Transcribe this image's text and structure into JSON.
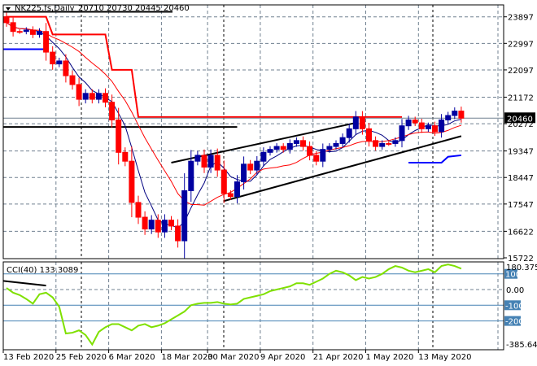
{
  "header": {
    "symbol_label": "NK225.fs,Daily",
    "ohlc_label": "20710 20730 20445 20460"
  },
  "indicator": {
    "label": "CCI(40) 133.3089"
  },
  "colors": {
    "bull": "#0000a0",
    "bear": "#ff0000",
    "ma_fast": "#000080",
    "ma_slow": "#ff0000",
    "step_line": "#ff0000",
    "cci": "#7fe000",
    "level": "#4682b4",
    "grid": "#708090"
  },
  "chart_data": [
    {
      "type": "candlestick",
      "title": "NK225.fs,Daily",
      "ylim": [
        15722,
        24400
      ],
      "y_ticks": [
        "23897",
        "22997",
        "22097",
        "21172",
        "20272",
        "19347",
        "18447",
        "17547",
        "16622",
        "15722"
      ],
      "y_tick_values": [
        23897,
        22997,
        22097,
        21172,
        20272,
        19347,
        18447,
        17547,
        16622,
        15722
      ],
      "current_price_label": "20460",
      "current_price": 20460,
      "x_tick_labels": [
        "13 Feb 2020",
        "25 Feb 2020",
        "6 Mar 2020",
        "18 Mar 2020",
        "30 Mar 2020",
        "9 Apr 2020",
        "21 Apr 2020",
        "1 May 2020",
        "13 May 2020"
      ],
      "x_tick_bars": [
        0,
        8,
        16,
        24,
        31,
        39,
        47,
        55,
        63
      ],
      "closes": [
        23700,
        23400,
        23400,
        23450,
        23300,
        23400,
        22700,
        22300,
        22400,
        21900,
        21600,
        21100,
        21300,
        21100,
        21300,
        21000,
        20400,
        19300,
        19000,
        17600,
        17100,
        16700,
        17000,
        16600,
        17000,
        16800,
        16300,
        18000,
        19000,
        19200,
        18800,
        19200,
        18700,
        17900,
        17800,
        18300,
        18900,
        18700,
        19000,
        19300,
        19400,
        19500,
        19400,
        19600,
        19700,
        19500,
        19200,
        19000,
        19400,
        19500,
        19600,
        19800,
        20100,
        20500,
        20100,
        19700,
        19500,
        19600,
        19600,
        19700,
        20200,
        20400,
        20300,
        20100,
        20200,
        20000,
        20400,
        20550,
        20700,
        20460
      ],
      "first_open": 23900,
      "step_line": [
        [
          0,
          23900
        ],
        [
          6,
          23900
        ],
        [
          7,
          23300
        ],
        [
          15,
          23300
        ],
        [
          16,
          22100
        ],
        [
          19,
          22100
        ],
        [
          20,
          20500
        ],
        [
          60,
          20500
        ]
      ],
      "support_line": [
        20272,
        0,
        35
      ],
      "wedge_upper": [
        [
          25,
          18950
        ],
        [
          53,
          20300
        ]
      ],
      "wedge_lower": [
        [
          33,
          17650
        ],
        [
          69,
          19850
        ]
      ],
      "blue_levels": [
        [
          [
            0,
            22800
          ],
          [
            6,
            22800
          ]
        ],
        [
          [
            61,
            18950
          ],
          [
            66,
            18950
          ],
          [
            67,
            19150
          ],
          [
            69,
            19200
          ]
        ]
      ]
    },
    {
      "type": "line",
      "title": "CCI(40)",
      "value_label": "133.3089",
      "ylim": [
        -385.64,
        180.3754
      ],
      "max_label": "180.3754",
      "min_label": "-385.640",
      "zero_label": "0.00",
      "levels": [
        100,
        -100,
        -200
      ],
      "level_labels": [
        "100",
        "-100",
        "-200"
      ],
      "values": [
        10,
        -20,
        -35,
        -60,
        -90,
        -30,
        -20,
        -50,
        -110,
        -280,
        -275,
        -260,
        -290,
        -350,
        -270,
        -240,
        -220,
        -220,
        -240,
        -260,
        -230,
        -220,
        -240,
        -230,
        -215,
        -190,
        -165,
        -140,
        -100,
        -90,
        -85,
        -85,
        -80,
        -90,
        -95,
        -90,
        -60,
        -50,
        -40,
        -30,
        -10,
        0,
        10,
        20,
        40,
        40,
        30,
        50,
        70,
        100,
        120,
        110,
        90,
        60,
        80,
        70,
        80,
        100,
        130,
        150,
        140,
        120,
        110,
        120,
        130,
        110,
        150,
        160,
        150,
        133
      ],
      "trendline": [
        [
          0,
          55
        ],
        [
          6,
          25
        ]
      ]
    }
  ]
}
